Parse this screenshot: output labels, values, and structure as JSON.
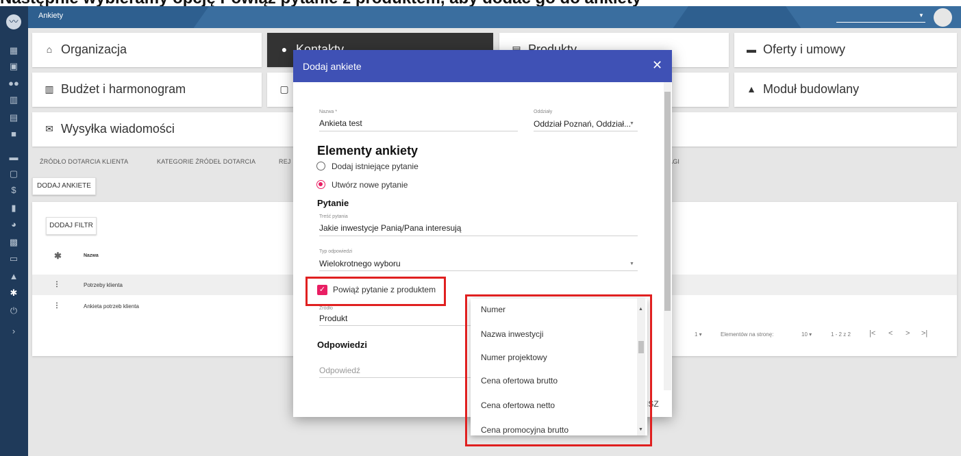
{
  "caption": {
    "text": "Następnie wybieramy opcję Powiąż pytanie z produktem, aby dodać go do ankiety"
  },
  "app": {
    "title": "Ankiety"
  },
  "modules": [
    {
      "label": "Organizacja",
      "icon": "home-icon"
    },
    {
      "label": "Kontakty",
      "icon": "person-icon"
    },
    {
      "label": "Produkty",
      "icon": "store-icon"
    },
    {
      "label": "Oferty i umowy",
      "icon": "folder-icon"
    },
    {
      "label": "Budżet i harmonogram",
      "icon": "building-icon"
    },
    {
      "label": "Moduł budowlany",
      "icon": "warning-icon"
    },
    {
      "label": "Wysyłka wiadomości",
      "icon": "mail-icon"
    }
  ],
  "subnav": {
    "items": [
      "ŹRÓDŁO DOTARCIA KLIENTA",
      "KATEGORIE ŹRÓDEŁ DOTARCIA",
      "REJ",
      "TAGI"
    ]
  },
  "toolbar": {
    "add_survey": "DODAJ ANKIETE",
    "add_filter": "DODAJ FILTR"
  },
  "table": {
    "header": "Nazwa",
    "rows": [
      "Potrzeby klienta",
      "Ankieta potrzeb klienta"
    ],
    "pager": {
      "per_page_label": "Elementów na stronę:",
      "per_page_value": "10",
      "range": "1 - 2 z 2",
      "page_value": "1"
    }
  },
  "dialog": {
    "title": "Dodaj ankiete",
    "name": {
      "label": "Nazwa *",
      "value": "Ankieta test"
    },
    "branches": {
      "label": "Oddziały",
      "value": "Oddział Poznań, Oddział..."
    },
    "elements_heading": "Elementy ankiety",
    "options": {
      "existing": "Dodaj istniejące pytanie",
      "new": "Utwórz nowe pytanie"
    },
    "question_heading": "Pytanie",
    "question": {
      "label": "Treść pytania",
      "value": "Jakie inwestycje Panią/Pana interesują"
    },
    "answer_type": {
      "label": "Typ odpowiedzi",
      "value": "Wielokrotnego wyboru"
    },
    "link_product": {
      "label": "Powiąż pytanie z produktem",
      "checked": true
    },
    "source": {
      "label": "Źródło",
      "value": "Produkt"
    },
    "answers_heading": "Odpowiedzi",
    "answer_placeholder": "Odpowiedź",
    "footer_fragment": "ISZ"
  },
  "source_dropdown": {
    "options": [
      "Numer",
      "Nazwa inwestycji",
      "Numer projektowy",
      "Cena ofertowa brutto",
      "Cena ofertowa netto",
      "Cena promocyjna brutto"
    ]
  },
  "colors": {
    "sidebar": "#1f3a5a",
    "topbar": "#2e5f8f",
    "dialog_header": "#3f51b5",
    "accent": "#e91e63",
    "highlight_box": "#e02020"
  }
}
